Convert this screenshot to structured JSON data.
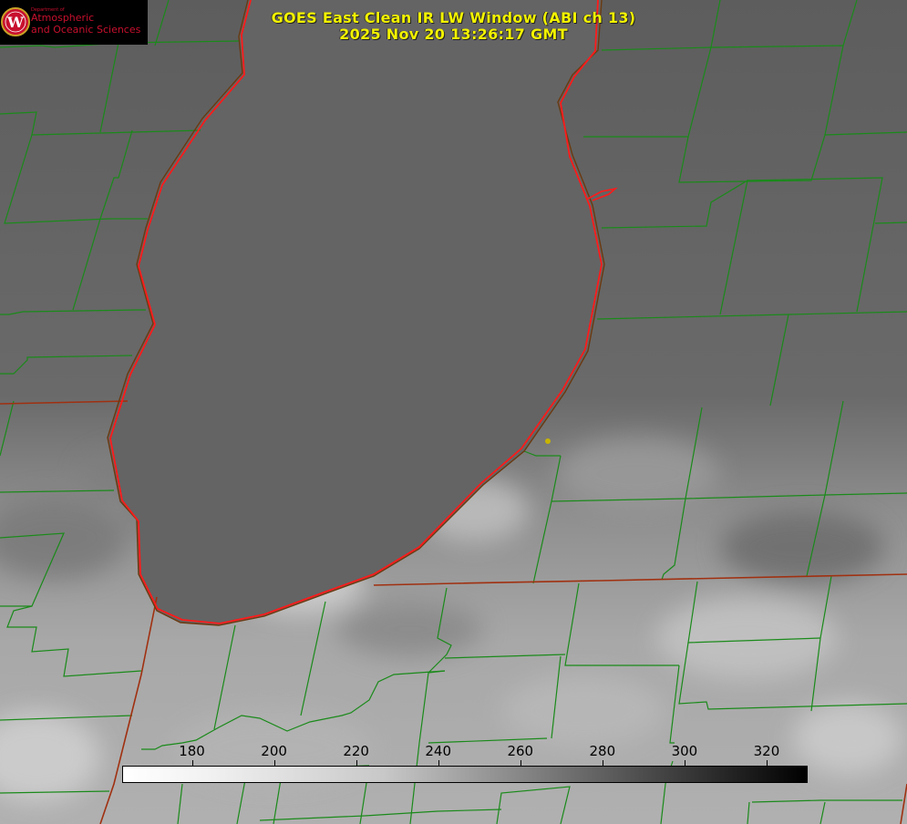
{
  "title": {
    "line1": "GOES East Clean IR LW Window (ABI ch 13)",
    "line2": "2025 Nov 20 13:26:17 GMT"
  },
  "logo": {
    "emblem_letter": "W",
    "small_text": "Department of",
    "line1": "Atmospheric",
    "line2": "and Oceanic Sciences",
    "color": "#c8102e"
  },
  "colorbar": {
    "ticks": [
      "180",
      "200",
      "220",
      "240",
      "260",
      "280",
      "300",
      "320"
    ],
    "min_value": 163,
    "max_value": 330,
    "colormap": "white-to-black"
  },
  "map": {
    "county_line_color": "#1a8a1a",
    "state_line_color": "#a03010",
    "lake_outline_color": "#ff1a1a",
    "marker_color": "#c8b400"
  }
}
